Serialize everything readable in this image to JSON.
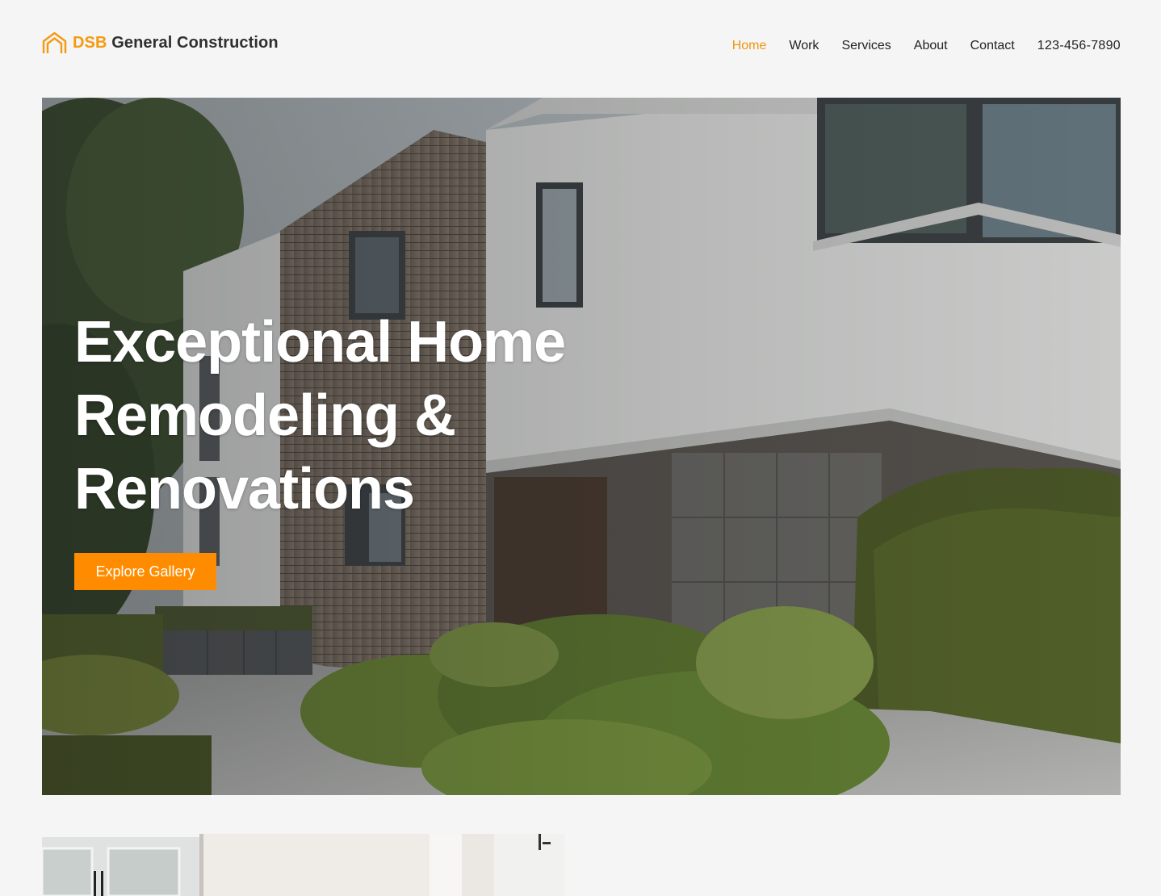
{
  "brand": {
    "accent": "DSB",
    "name": "General Construction",
    "accent_color": "#f59a10",
    "logo_icon": "house-outline-icon"
  },
  "nav": {
    "items": [
      {
        "label": "Home",
        "active": true
      },
      {
        "label": "Work",
        "active": false
      },
      {
        "label": "Services",
        "active": false
      },
      {
        "label": "About",
        "active": false
      },
      {
        "label": "Contact",
        "active": false
      }
    ],
    "phone": "123-456-7890",
    "active_color": "#f0960c"
  },
  "hero": {
    "title": "Exceptional Home Remodeling & Renovations",
    "button_label": "Explore Gallery",
    "button_color": "#ff8c00",
    "image": "modern-house-exterior-photo"
  },
  "gallery_preview": {
    "image": "white-kitchen-cabinets-photo"
  }
}
